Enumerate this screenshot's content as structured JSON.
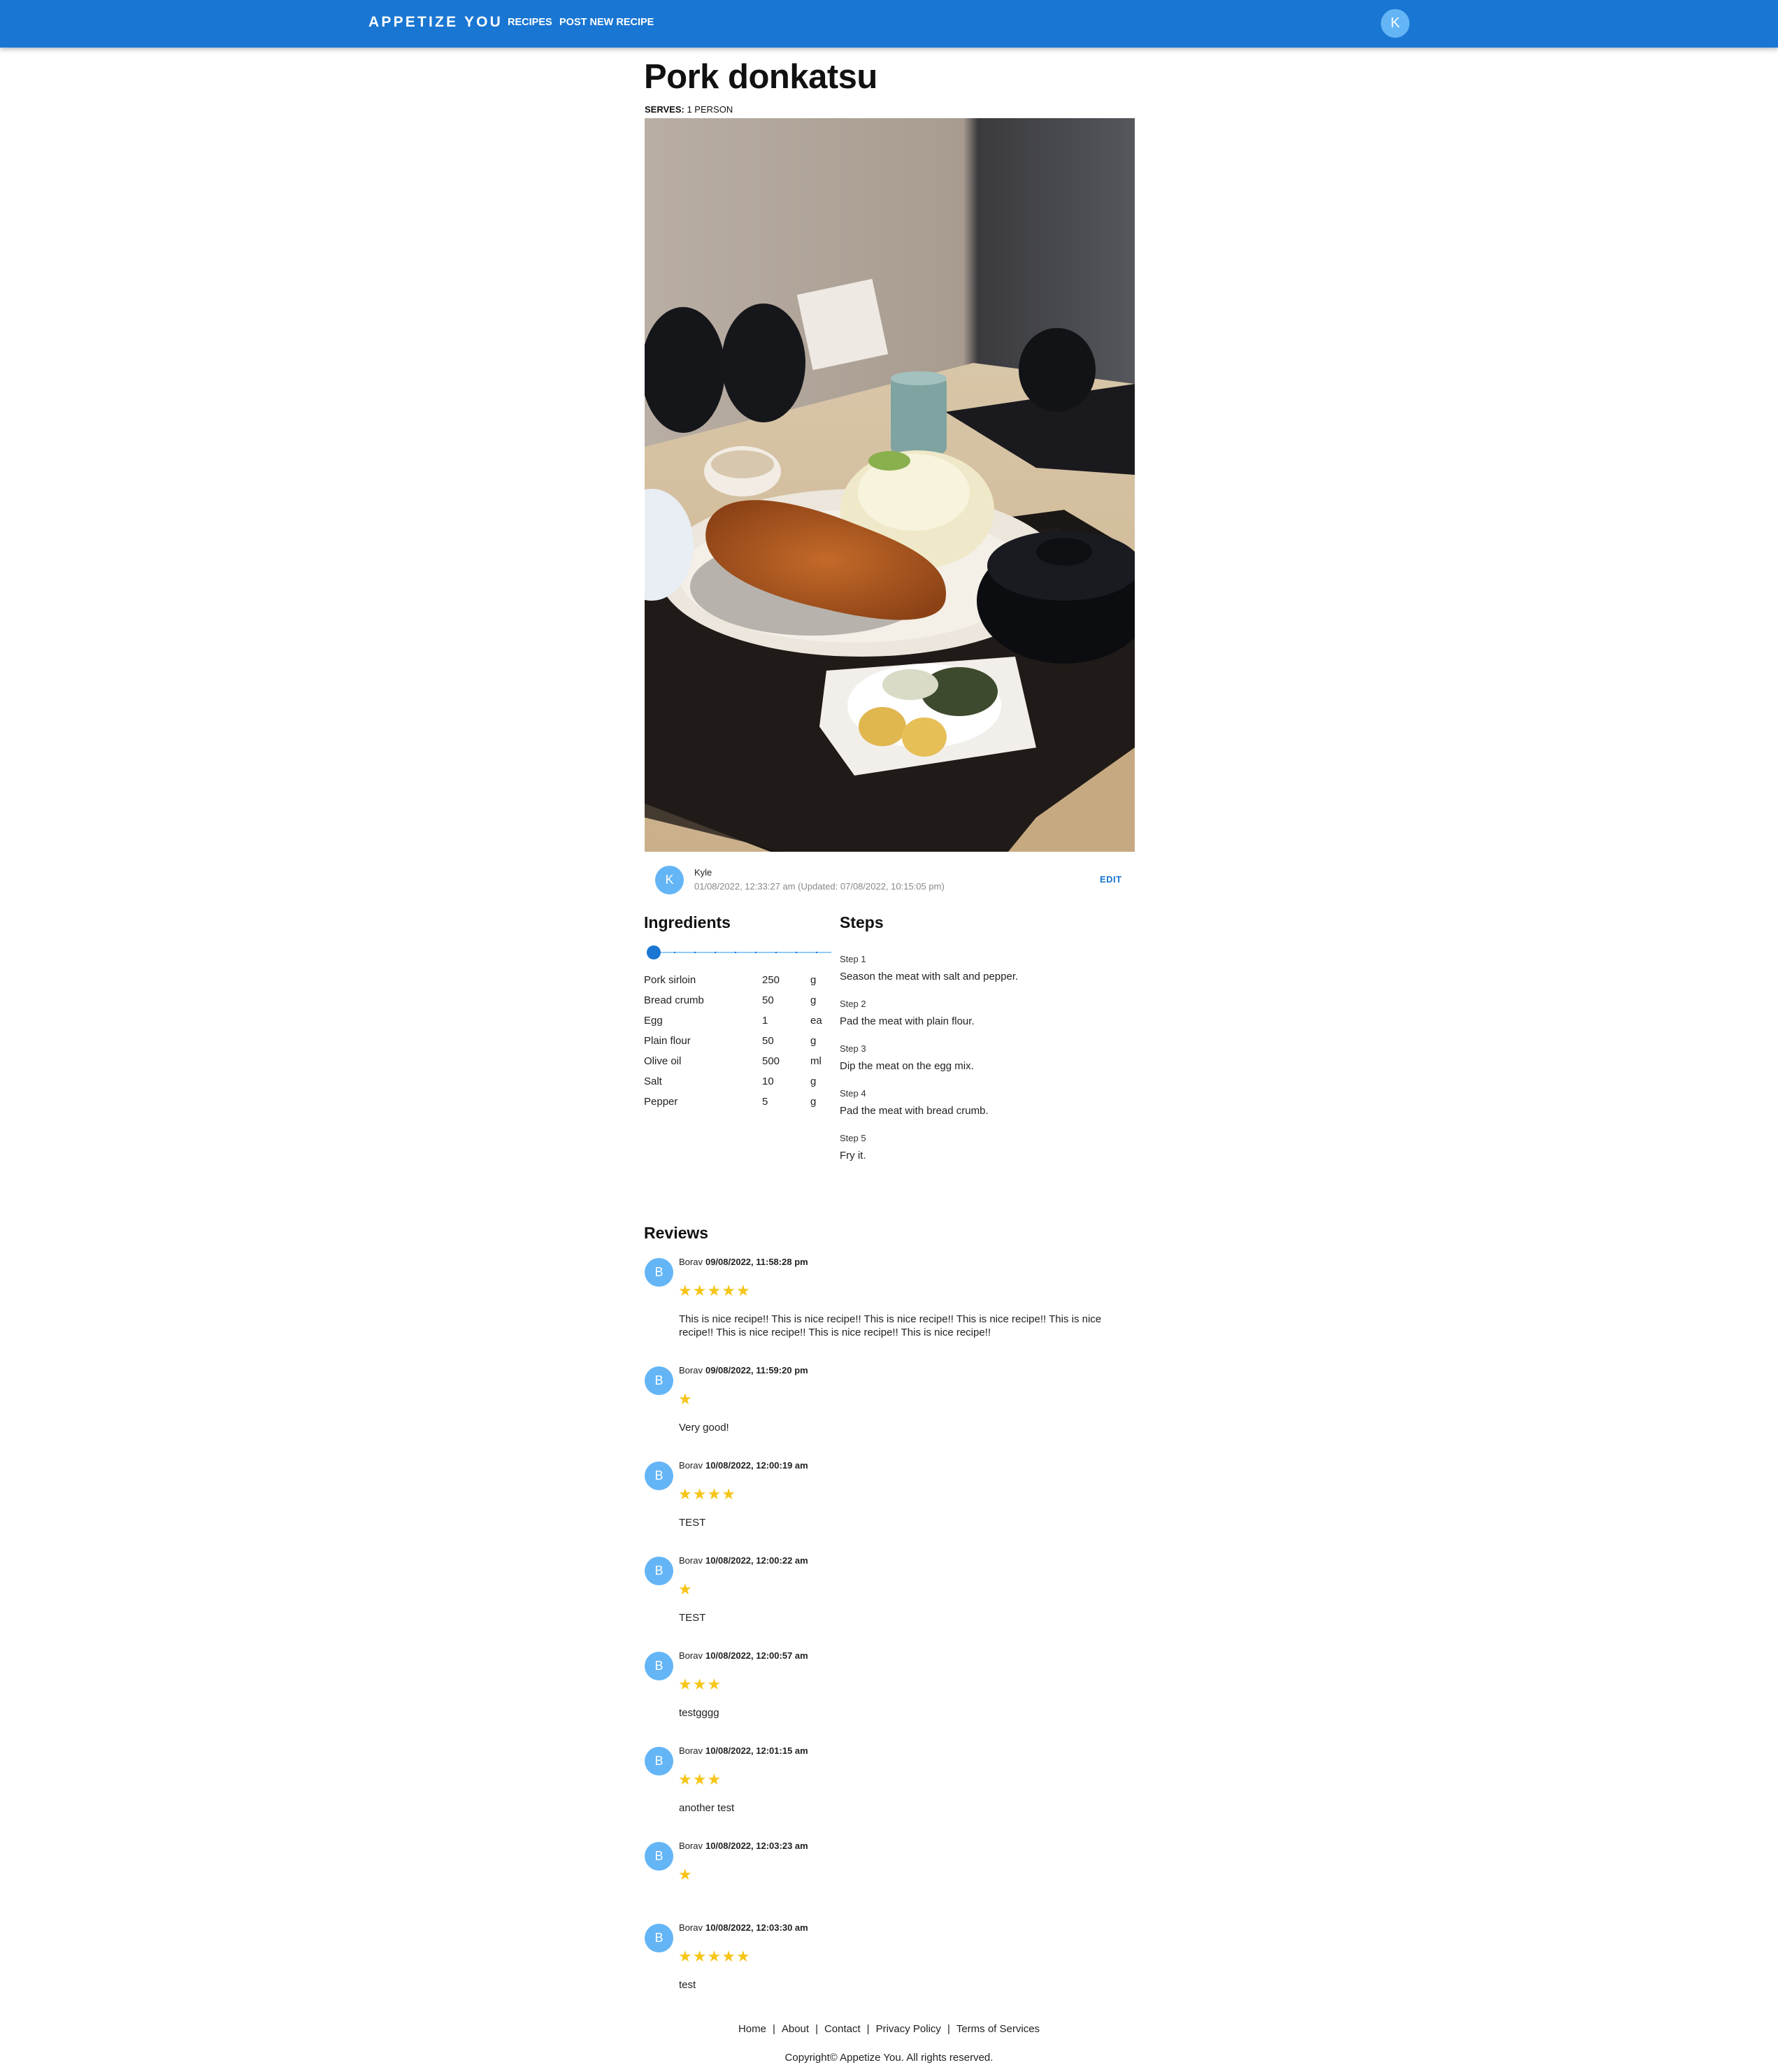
{
  "header": {
    "brand": "APPETIZE YOU",
    "nav": [
      "RECIPES",
      "POST NEW RECIPE"
    ],
    "user_initial": "K"
  },
  "recipe": {
    "title": "Pork donkatsu",
    "serves_label": "SERVES:",
    "serves_value": "1 PERSON",
    "author": {
      "initial": "K",
      "name": "Kyle",
      "date": "01/08/2022, 12:33:27 am (Updated: 07/08/2022, 10:15:05 pm)"
    },
    "edit_label": "EDIT"
  },
  "ingredients": {
    "title": "Ingredients",
    "slider_value": 0,
    "items": [
      {
        "name": "Pork sirloin",
        "qty": "250",
        "unit": "g"
      },
      {
        "name": "Bread crumb",
        "qty": "50",
        "unit": "g"
      },
      {
        "name": "Egg",
        "qty": "1",
        "unit": "ea"
      },
      {
        "name": "Plain flour",
        "qty": "50",
        "unit": "g"
      },
      {
        "name": "Olive oil",
        "qty": "500",
        "unit": "ml"
      },
      {
        "name": "Salt",
        "qty": "10",
        "unit": "g"
      },
      {
        "name": "Pepper",
        "qty": "5",
        "unit": "g"
      }
    ]
  },
  "steps": {
    "title": "Steps",
    "items": [
      {
        "label": "Step 1",
        "text": "Season the meat with salt and pepper."
      },
      {
        "label": "Step 2",
        "text": "Pad the meat with plain flour."
      },
      {
        "label": "Step 3",
        "text": "Dip the meat on the egg mix."
      },
      {
        "label": "Step 4",
        "text": "Pad the meat with bread crumb."
      },
      {
        "label": "Step 5",
        "text": "Fry it."
      }
    ]
  },
  "reviews": {
    "title": "Reviews",
    "star_color": "#f5c518",
    "items": [
      {
        "initial": "B",
        "name": "Borav",
        "date": "09/08/2022, 11:58:28 pm",
        "rating": 5,
        "text": "This is nice recipe!! This is nice recipe!! This is nice recipe!! This is nice recipe!! This is nice recipe!! This is nice recipe!! This is nice recipe!! This is nice recipe!!"
      },
      {
        "initial": "B",
        "name": "Borav",
        "date": "09/08/2022, 11:59:20 pm",
        "rating": 1,
        "text": "Very good!"
      },
      {
        "initial": "B",
        "name": "Borav",
        "date": "10/08/2022, 12:00:19 am",
        "rating": 4,
        "text": "TEST"
      },
      {
        "initial": "B",
        "name": "Borav",
        "date": "10/08/2022, 12:00:22 am",
        "rating": 1,
        "text": "TEST"
      },
      {
        "initial": "B",
        "name": "Borav",
        "date": "10/08/2022, 12:00:57 am",
        "rating": 3,
        "text": "testgggg"
      },
      {
        "initial": "B",
        "name": "Borav",
        "date": "10/08/2022, 12:01:15 am",
        "rating": 3,
        "text": "another test"
      },
      {
        "initial": "B",
        "name": "Borav",
        "date": "10/08/2022, 12:03:23 am",
        "rating": 1,
        "text": ""
      },
      {
        "initial": "B",
        "name": "Borav",
        "date": "10/08/2022, 12:03:30 am",
        "rating": 5,
        "text": "test"
      }
    ]
  },
  "footer": {
    "links": [
      "Home",
      "About",
      "Contact",
      "Privacy Policy",
      "Terms of Services"
    ],
    "copyright": "Copyright© Appetize You. All rights reserved."
  },
  "colors": {
    "appbar": "#1976d2",
    "avatar": "#64b5f6",
    "link": "#1976d2"
  }
}
